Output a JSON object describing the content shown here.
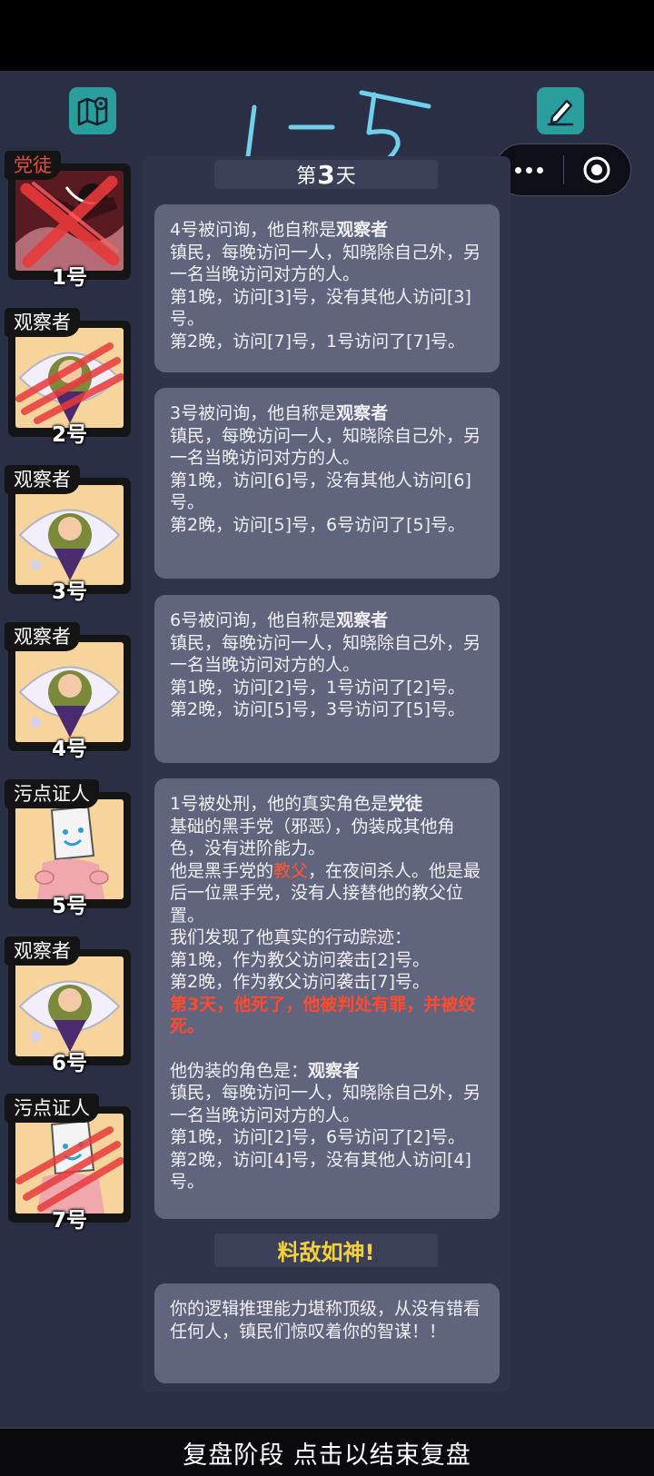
{
  "header": {
    "map_icon": "map-pin-icon",
    "notes_icon": "pen-note-icon",
    "menu_more": "more-dots-icon",
    "menu_close": "target-circle-icon",
    "handwriting": "1-5"
  },
  "day": {
    "prefix": "第",
    "number": "3",
    "suffix": "天"
  },
  "players": [
    {
      "role": "党徒",
      "number": "1号",
      "role_color": "#e74c3c",
      "status": "eliminated",
      "portrait": "dark-red-figure"
    },
    {
      "role": "观察者",
      "number": "2号",
      "role_color": "#ffffff",
      "status": "killed",
      "portrait": "eye-girl"
    },
    {
      "role": "观察者",
      "number": "3号",
      "role_color": "#ffffff",
      "status": "alive",
      "portrait": "eye-girl"
    },
    {
      "role": "观察者",
      "number": "4号",
      "role_color": "#ffffff",
      "status": "alive",
      "portrait": "eye-girl"
    },
    {
      "role": "污点证人",
      "number": "5号",
      "role_color": "#ffffff",
      "status": "alive",
      "portrait": "bag-head"
    },
    {
      "role": "观察者",
      "number": "6号",
      "role_color": "#ffffff",
      "status": "alive",
      "portrait": "eye-girl"
    },
    {
      "role": "污点证人",
      "number": "7号",
      "role_color": "#ffffff",
      "status": "killed",
      "portrait": "bag-head"
    }
  ],
  "messages": {
    "m1": {
      "intro": "4号被问询，他自称是",
      "role": "观察者",
      "lines": [
        "镇民，每晚访问一人，知晓除自己外，另一名当晚访问对方的人。",
        "第1晚，访问[3]号，没有其他人访问[3]号。",
        "第2晚，访问[7]号，1号访问了[7]号。"
      ]
    },
    "m2": {
      "intro": "3号被问询，他自称是",
      "role": "观察者",
      "lines": [
        "镇民，每晚访问一人，知晓除自己外，另一名当晚访问对方的人。",
        "第1晚，访问[6]号，没有其他人访问[6]号。",
        "第2晚，访问[5]号，6号访问了[5]号。"
      ]
    },
    "m3": {
      "intro": "6号被问询，他自称是",
      "role": "观察者",
      "lines": [
        "镇民，每晚访问一人，知晓除自己外，另一名当晚访问对方的人。",
        "第1晚，访问[2]号，1号访问了[2]号。",
        "第2晚，访问[5]号，3号访问了[5]号。"
      ]
    },
    "m4": {
      "intro": "1号被处刑，他的真实角色是",
      "role": "党徒",
      "desc": "基础的黑手党（邪恶），伪装成其他角色，没有进阶能力。",
      "godfather_pre": "他是黑手党的",
      "godfather": "教父",
      "godfather_post": "，在夜间杀人。他是最后一位黑手党，没有人接替他的教父位置。",
      "trail_title": "我们发现了他真实的行动踪迹：",
      "trail": [
        "第1晚，作为教父访问袭击[2]号。",
        "第2晚，作为教父访问袭击[7]号。"
      ],
      "verdict": "第3天，他死了，他被判处有罪，并被绞死。",
      "disguise_label": "他伪装的角色是：",
      "disguise_role": "观察者",
      "disguise_lines": [
        "镇民，每晚访问一人，知晓除自己外，另一名当晚访问对方的人。",
        "第1晚，访问[2]号，6号访问了[2]号。",
        "第2晚，访问[4]号，没有其他人访问[4]号。"
      ]
    },
    "rating": "料敌如神!",
    "m5": "你的逻辑推理能力堪称顶级，从没有错看任何人，镇民们惊叹着你的智谋！！"
  },
  "footer": {
    "label": "复盘阶段 点击以结束复盘"
  },
  "colors": {
    "background": "#2b2f45",
    "bubble": "#61647d",
    "accent_teal": "#2a9d9d",
    "highlight_red": "#ff4a2e",
    "rating_yellow": "#f4d23c"
  }
}
